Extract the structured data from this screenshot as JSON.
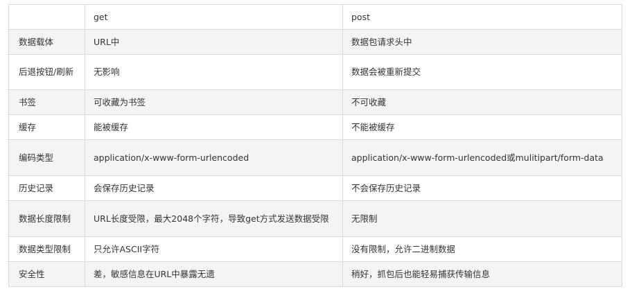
{
  "table": {
    "header": {
      "label": "",
      "get": "get",
      "post": "post"
    },
    "rows": [
      {
        "label": "数据载体",
        "get": "URL中",
        "post": "数据包请求头中"
      },
      {
        "label": "后退按钮/刷新",
        "get": "无影响",
        "post": "数据会被重新提交"
      },
      {
        "label": "书签",
        "get": "可收藏为书签",
        "post": "不可收藏"
      },
      {
        "label": "缓存",
        "get": "能被缓存",
        "post": "不能被缓存"
      },
      {
        "label": "编码类型",
        "get": "application/x-www-form-urlencoded",
        "post": "application/x-www-form-urlencoded或mulitipart/form-data"
      },
      {
        "label": "历史记录",
        "get": "会保存历史记录",
        "post": "不会保存历史记录"
      },
      {
        "label": "数据长度限制",
        "get": "URL长度受限，最大2048个字符，导致get方式发送数据受限",
        "post": "无限制"
      },
      {
        "label": "数据类型限制",
        "get": "只允许ASCII字符",
        "post": "没有限制，允许二进制数据"
      },
      {
        "label": "安全性",
        "get": "差，敏感信息在URL中暴露无遗",
        "post": "稍好，抓包后也能轻易捕获传输信息"
      }
    ]
  }
}
